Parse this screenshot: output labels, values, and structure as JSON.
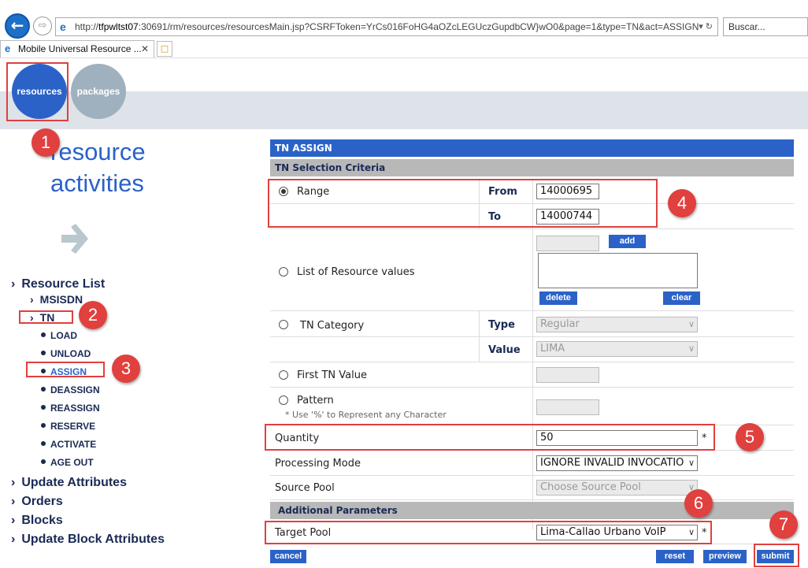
{
  "browser": {
    "url_prefix": "http://",
    "url_host": "tfpwltst07",
    "url_rest": ":30691/rm/resources/resourcesMain.jsp?CSRFToken=YrCs016FoHG4aOZcLEGUczGupdbCW}wO0&page=1&type=TN&act=ASSIGN",
    "search_placeholder": "Buscar...",
    "tab_title": "Mobile Universal Resource ..."
  },
  "app": {
    "tabs": [
      "resources",
      "packages"
    ],
    "title_line1": "resource",
    "title_line2": "activities"
  },
  "nav": {
    "resource_list": "Resource List",
    "msisdn": "MSISDN",
    "tn": "TN",
    "tn_actions": [
      "LOAD",
      "UNLOAD",
      "ASSIGN",
      "DEASSIGN",
      "REASSIGN",
      "RESERVE",
      "ACTIVATE",
      "AGE OUT"
    ],
    "update_attributes": "Update Attributes",
    "orders": "Orders",
    "blocks": "Blocks",
    "update_block_attributes": "Update Block Attributes"
  },
  "form": {
    "header": "TN ASSIGN",
    "criteria_header": "TN Selection Criteria",
    "range_label": "Range",
    "from_label": "From",
    "from_value": "14000695",
    "to_label": "To",
    "to_value": "14000744",
    "list_label": "List of Resource values",
    "add_label": "add",
    "delete_label": "delete",
    "clear_label": "clear",
    "category_label": "TN Category",
    "type_label": "Type",
    "type_value": "Regular",
    "value_label": "Value",
    "value_value": "LIMA",
    "first_tn_label": "First TN Value",
    "pattern_label": "Pattern",
    "pattern_hint": "* Use '%' to Represent any Character",
    "quantity_label": "Quantity",
    "quantity_value": "50",
    "required_mark": "*",
    "processing_label": "Processing Mode",
    "processing_value": "IGNORE INVALID INVOCATIO",
    "source_pool_label": "Source Pool",
    "source_pool_value": "Choose Source Pool",
    "additional_header": "Additional Parameters",
    "target_pool_label": "Target Pool",
    "target_pool_value": "Lima-Callao Urbano VoIP",
    "cancel_label": "cancel",
    "reset_label": "reset",
    "preview_label": "preview",
    "submit_label": "submit"
  },
  "annotations": [
    "1",
    "2",
    "3",
    "4",
    "5",
    "6",
    "7"
  ],
  "colors": {
    "accent": "#2b62c8",
    "marker": "#e0403e",
    "nav_text": "#1a2a55"
  }
}
